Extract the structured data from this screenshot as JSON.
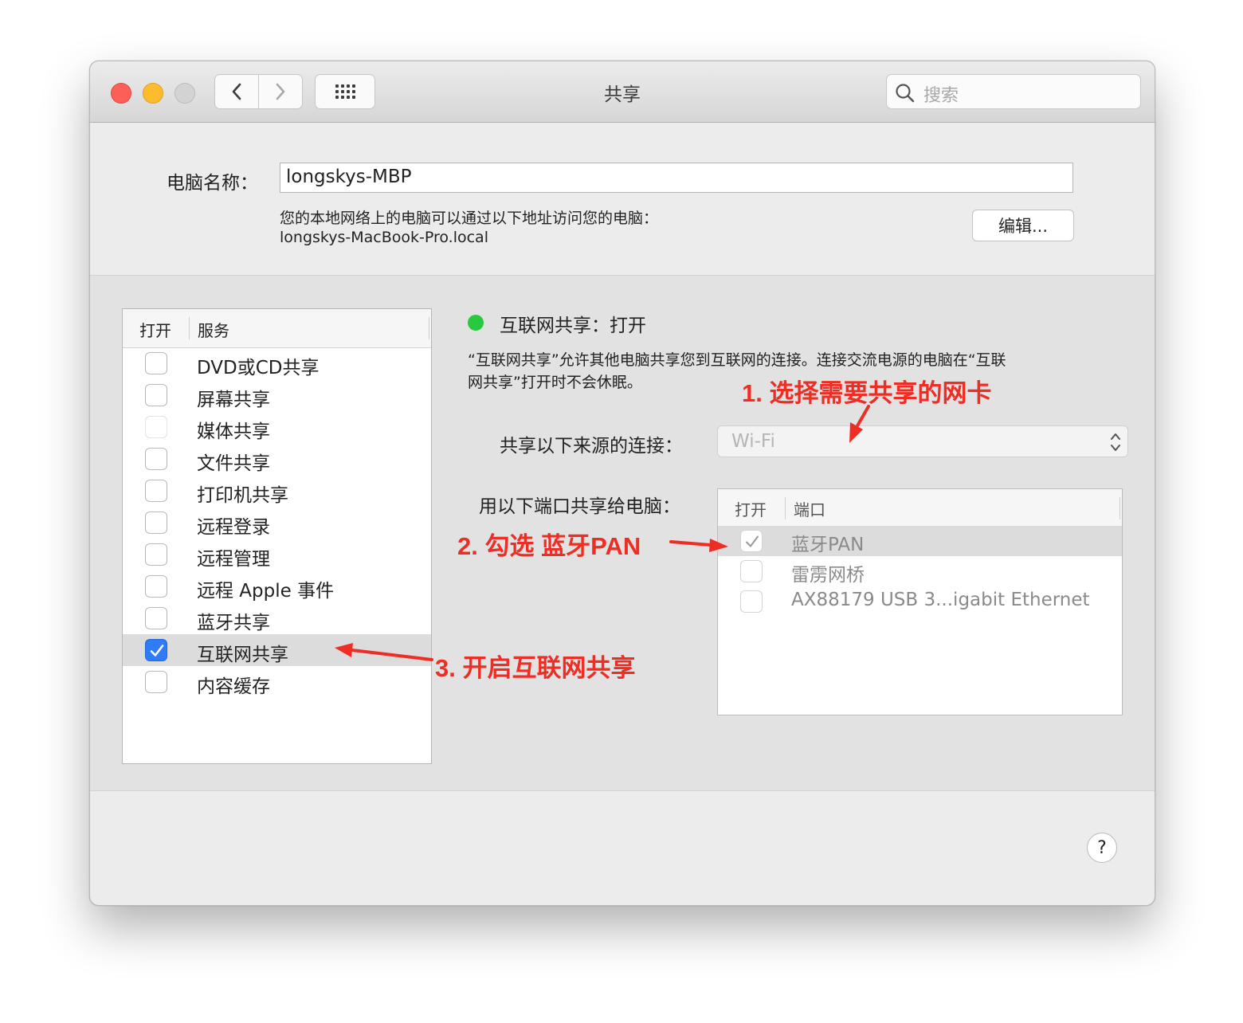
{
  "window": {
    "title": "共享"
  },
  "toolbar": {
    "search_placeholder": "搜索"
  },
  "computer": {
    "name_label": "电脑名称：",
    "name_value": "longskys-MBP",
    "address_desc": "您的本地网络上的电脑可以通过以下地址访问您的电脑：",
    "address": "longskys-MacBook-Pro.local",
    "edit_label": "编辑..."
  },
  "services": {
    "header_on": "打开",
    "header_service": "服务",
    "items": [
      {
        "label": "DVD或CD共享",
        "checked": false
      },
      {
        "label": "屏幕共享",
        "checked": false
      },
      {
        "label": "媒体共享",
        "checked": false
      },
      {
        "label": "文件共享",
        "checked": false
      },
      {
        "label": "打印机共享",
        "checked": false
      },
      {
        "label": "远程登录",
        "checked": false
      },
      {
        "label": "远程管理",
        "checked": false
      },
      {
        "label": "远程 Apple 事件",
        "checked": false
      },
      {
        "label": "蓝牙共享",
        "checked": false
      },
      {
        "label": "互联网共享",
        "checked": true
      },
      {
        "label": "内容缓存",
        "checked": false
      }
    ]
  },
  "detail": {
    "status": "互联网共享：打开",
    "status_color": "#28c940",
    "info_line1": "“互联网共享”允许其他电脑共享您到互联网的连接。连接交流电源的电脑在“互联",
    "info_line2": "网共享”打开时不会休眠。",
    "source_label": "共享以下来源的连接：",
    "source_value": "Wi-Fi",
    "ports_label": "用以下端口共享给电脑：",
    "ports_header_on": "打开",
    "ports_header_port": "端口",
    "ports": [
      {
        "label": "蓝牙PAN",
        "checked": true
      },
      {
        "label": "雷雳网桥",
        "checked": false
      },
      {
        "label": "AX88179 USB 3...igabit Ethernet",
        "checked": false
      }
    ]
  },
  "help": "?",
  "annotations": {
    "step1": "1. 选择需要共享的网卡",
    "step2": "2. 勾选 蓝牙PAN",
    "step3": "3. 开启互联网共享",
    "color": "#ee2d24"
  }
}
